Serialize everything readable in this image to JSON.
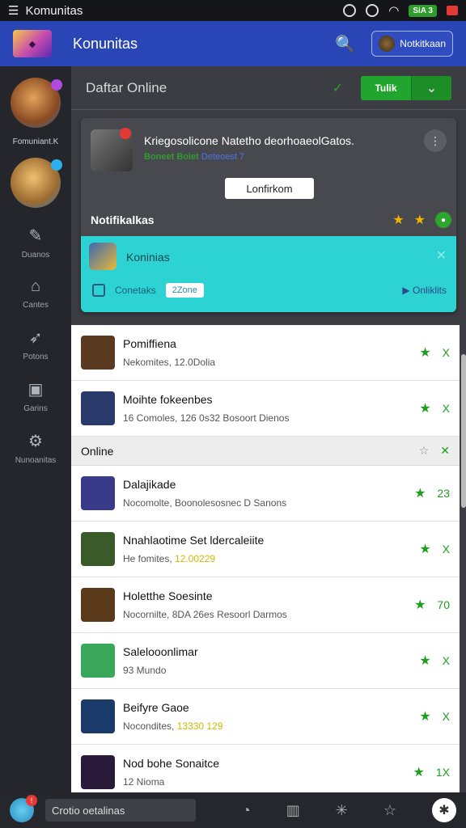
{
  "statusbar": {
    "title": "Komunitas",
    "badge": "SiA 3"
  },
  "header": {
    "title": "Konunitas",
    "button_label": "Notkitkaan"
  },
  "sidebar": {
    "username": "Fomuniant.K",
    "nav": [
      "Duanos",
      "Cantes",
      "Potons",
      "Garins",
      "Nunoanitas"
    ]
  },
  "main": {
    "online_label": "Daftar Online",
    "split_button": "Tulik",
    "card": {
      "title": "Kriegosolicone Natetho deorhoaeolGatos.",
      "sub_green": "Boneet Boiet",
      "sub_blue": "Deteoest 7",
      "confirm": "Lonfirkom",
      "notif_title": "Notifikalkas"
    },
    "cyan": {
      "name": "Koninias",
      "left_label": "Conetaks",
      "pill": "2Zone",
      "right_label": "Onliklits"
    },
    "list": [
      {
        "name": "Pomiffiena",
        "sub": "Nekomites, 12.0Dolia",
        "hl": "",
        "action": "X",
        "thumb": "#5a3a20"
      },
      {
        "name": "Moihte fokeenbes",
        "sub": "16 Comoles, 126 0s32 Bosoort Dienos",
        "hl": "",
        "action": "X",
        "thumb": "#2a3a6a"
      }
    ],
    "section": "Online",
    "list2": [
      {
        "name": "Dalajikade",
        "sub": "Nocomolte, Boonolesosnec D Sanons",
        "hl": "",
        "action": "23",
        "thumb": "#3a3a8a"
      },
      {
        "name": "Nnahlaotime Set ldercaleiite",
        "sub": "He fomites,",
        "hl": "12.00229",
        "action": "X",
        "thumb": "#3a5a2a"
      },
      {
        "name": "Holetthe Soesinte",
        "sub": "Nocornilte, 8DA 26es Resoorl Darmos",
        "hl": "",
        "action": "70",
        "thumb": "#5a3a1a"
      },
      {
        "name": "Salelooonlimar",
        "sub": "93 Mundo",
        "hl": "",
        "action": "X",
        "thumb": "#3aa85a"
      },
      {
        "name": "Beifyre Gaoe",
        "sub": "Nocondites,",
        "hl": "13330 129",
        "action": "X",
        "thumb": "#1a3a6a"
      },
      {
        "name": "Nod bohe Sonaitce",
        "sub": "12 Nioma",
        "hl": "",
        "action": "1X",
        "thumb": "#2a1a3a"
      }
    ]
  },
  "bottom": {
    "input": "Crotio oetalinas"
  }
}
